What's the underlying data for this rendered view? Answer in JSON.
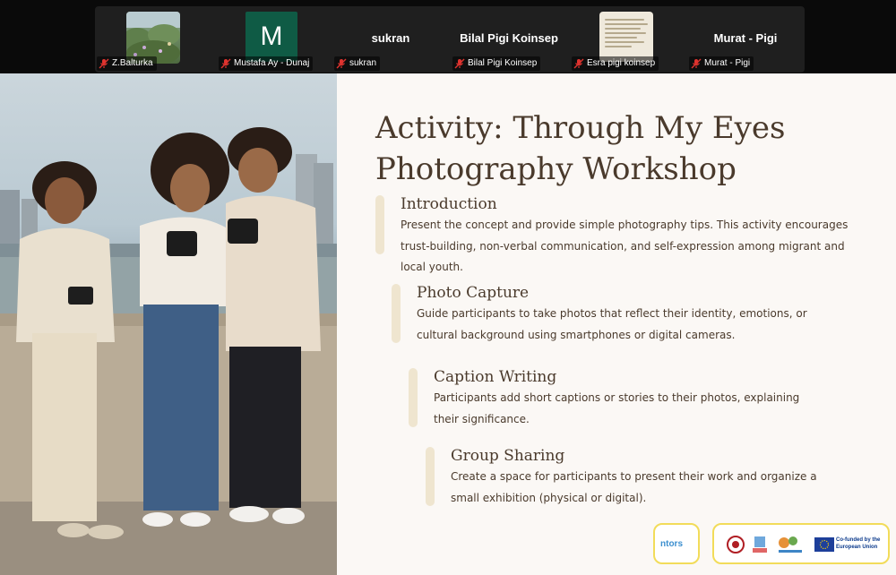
{
  "meeting": {
    "participants": [
      {
        "name": "Z.Balturka",
        "tile_type": "video-thumbnail"
      },
      {
        "name": "Mustafa Ay - Dunaj",
        "tile_type": "initial-avatar",
        "initial": "M"
      },
      {
        "name": "sukran",
        "tile_type": "name-only",
        "display_name": "sukran"
      },
      {
        "name": "Bilal Pigi Koinsep",
        "tile_type": "name-only",
        "display_name": "Bilal Pigi Koinsep"
      },
      {
        "name": "Esra pigi koinsep",
        "tile_type": "video-thumbnail"
      },
      {
        "name": "Murat - Pigi",
        "tile_type": "name-only",
        "display_name": "Murat - Pigi"
      }
    ],
    "mic_status_icon": "mic-off-icon",
    "mic_color": "#e0332f"
  },
  "slide": {
    "title_line1": "Activity: Through My Eyes",
    "title_line2": "Photography Workshop",
    "sections": [
      {
        "heading": "Introduction",
        "body": "Present the concept and provide simple photography tips. This activity encourages trust-building, non-verbal communication, and self-expression among migrant and local youth."
      },
      {
        "heading": "Photo Capture",
        "body": "Guide participants to take photos that reflect their identity, emotions, or cultural background using smartphones or digital cameras."
      },
      {
        "heading": "Caption Writing",
        "body": "Participants add short captions or stories to their photos, explaining their significance."
      },
      {
        "heading": "Group Sharing",
        "body": "Create a space for participants to present their work and organize a small exhibition (physical or digital)."
      }
    ],
    "logos": {
      "project_logo": "ntors",
      "eu_label": "Co-funded by the European Union"
    },
    "colors": {
      "text": "#4a3a2c",
      "accent_bar": "#efe5cf",
      "background": "#fbf8f5",
      "logo_border": "#f2dc5a"
    }
  }
}
